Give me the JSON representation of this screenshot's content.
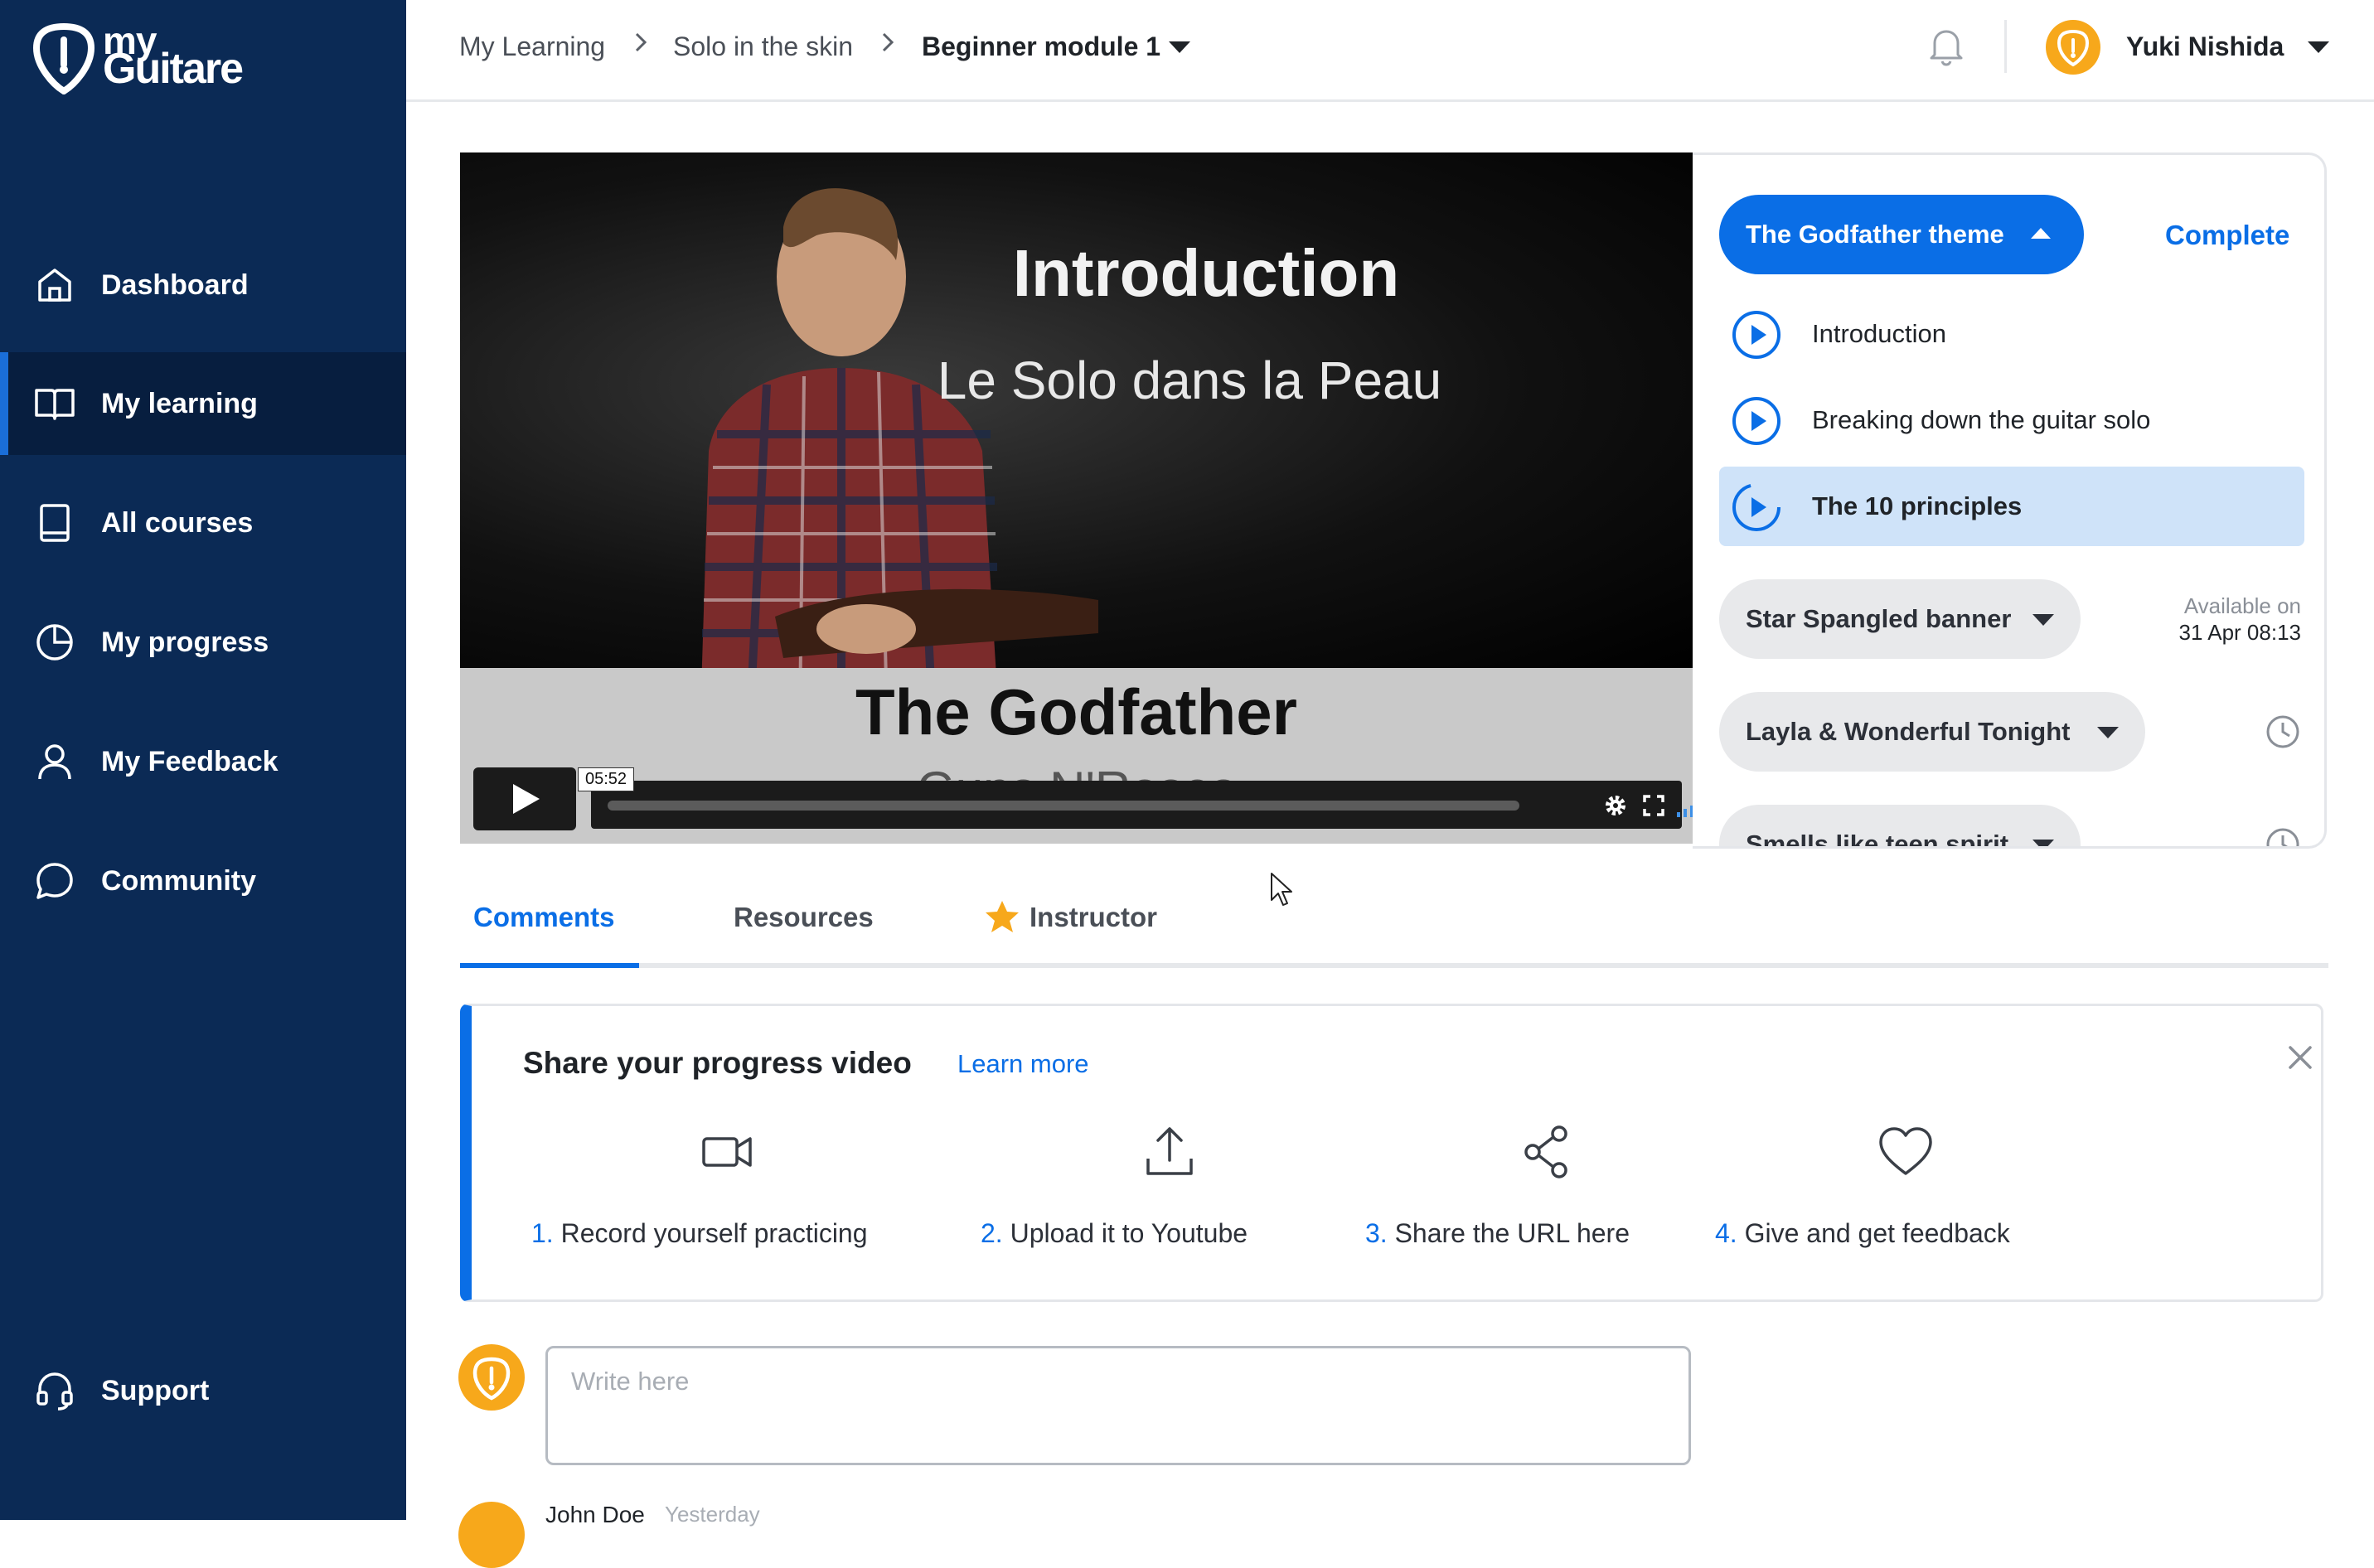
{
  "app": {
    "logo_line1": "my",
    "logo_line2": "Guitare"
  },
  "sidebar": {
    "items": [
      {
        "label": "Dashboard",
        "icon": "home-icon"
      },
      {
        "label": "My learning",
        "icon": "book-open-icon",
        "active": true
      },
      {
        "label": "All courses",
        "icon": "book-icon"
      },
      {
        "label": "My progress",
        "icon": "pie-chart-icon"
      },
      {
        "label": "My Feedback",
        "icon": "user-icon"
      },
      {
        "label": "Community",
        "icon": "chat-bubble-icon"
      }
    ],
    "support_label": "Support"
  },
  "breadcrumb": {
    "items": [
      "My Learning",
      "Solo in the skin",
      "Beginner module 1"
    ]
  },
  "user": {
    "name": "Yuki Nishida"
  },
  "video": {
    "title": "Introduction",
    "subtitle": "Le Solo dans la Peau",
    "song": "The Godfather",
    "artist": "Guns N'Roses",
    "time": "05:52"
  },
  "playlist": {
    "current_section": "The Godfather theme",
    "complete_label": "Complete",
    "lessons": [
      {
        "label": "Introduction"
      },
      {
        "label": "Breaking down the guitar solo"
      },
      {
        "label": "The 10 principles",
        "active": true
      }
    ],
    "sections": [
      {
        "label": "Star Spangled banner",
        "available_label": "Available on",
        "available_date": "31 Apr 08:13"
      },
      {
        "label": "Layla & Wonderful Tonight"
      },
      {
        "label": "Smells like teen spirit"
      }
    ]
  },
  "tabs": [
    {
      "label": "Comments",
      "active": true
    },
    {
      "label": "Resources"
    },
    {
      "label": "Instructor",
      "icon": "star-icon"
    }
  ],
  "share": {
    "title": "Share your progress video",
    "learn_more": "Learn more",
    "steps": [
      {
        "num": "1.",
        "label": "Record yourself practicing",
        "icon": "video-camera-icon"
      },
      {
        "num": "2.",
        "label": "Upload it to Youtube",
        "icon": "upload-icon"
      },
      {
        "num": "3.",
        "label": "Share the URL here",
        "icon": "share-icon"
      },
      {
        "num": "4.",
        "label": "Give and get feedback",
        "icon": "heart-icon"
      }
    ]
  },
  "comment_box": {
    "placeholder": "Write here"
  },
  "comments": [
    {
      "author": "John Doe",
      "time": "Yesterday"
    }
  ],
  "colors": {
    "sidebar": "#0b2a55",
    "accent": "#0a6ee6",
    "avatar": "#f7a81b",
    "active_lesson_bg": "#cfe3f9"
  }
}
